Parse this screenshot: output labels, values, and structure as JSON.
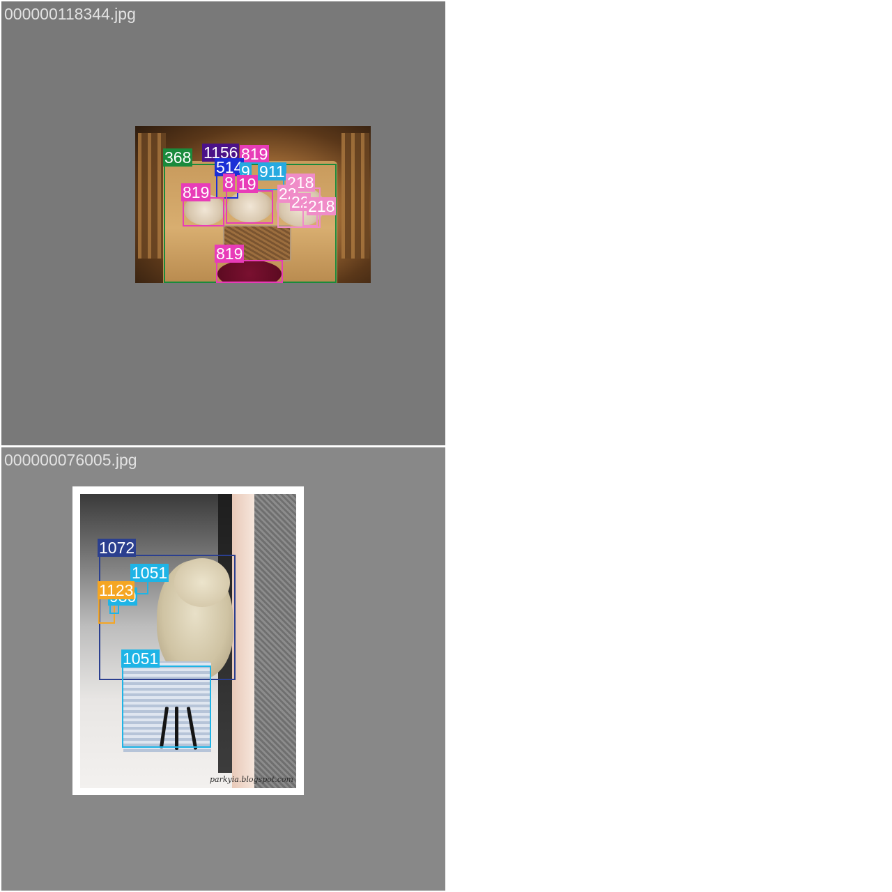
{
  "panels": [
    {
      "filename": "000000118344.jpg",
      "detections": [
        {
          "label": "368",
          "color": "#1a8a3c"
        },
        {
          "label": "1156",
          "color": "#4b1288"
        },
        {
          "label": "819",
          "color": "#e83cb8"
        },
        {
          "label": "514",
          "color": "#1b2fd6"
        },
        {
          "label": "9",
          "color": "#26a9e0"
        },
        {
          "label": "911",
          "color": "#26a9e0"
        },
        {
          "label": "8",
          "color": "#e83cb8"
        },
        {
          "label": "819",
          "color": "#e83cb8"
        },
        {
          "label": "19",
          "color": "#e83cb8"
        },
        {
          "label": "218",
          "color": "#f08cc8"
        },
        {
          "label": "22",
          "color": "#f08cc8"
        },
        {
          "label": "22",
          "color": "#f08cc8"
        },
        {
          "label": "218",
          "color": "#f08cc8"
        },
        {
          "label": "819",
          "color": "#e83cb8"
        }
      ]
    },
    {
      "filename": "000000076005.jpg",
      "watermark": "parkyia.blogspot.com",
      "detections": [
        {
          "label": "1072",
          "color": "#2b3f8f"
        },
        {
          "label": "1051",
          "color": "#1eb4e6"
        },
        {
          "label": "1123",
          "color": "#f5a623"
        },
        {
          "label": "930",
          "color": "#1eb4e6"
        },
        {
          "label": "1051",
          "color": "#1eb4e6"
        }
      ]
    }
  ]
}
